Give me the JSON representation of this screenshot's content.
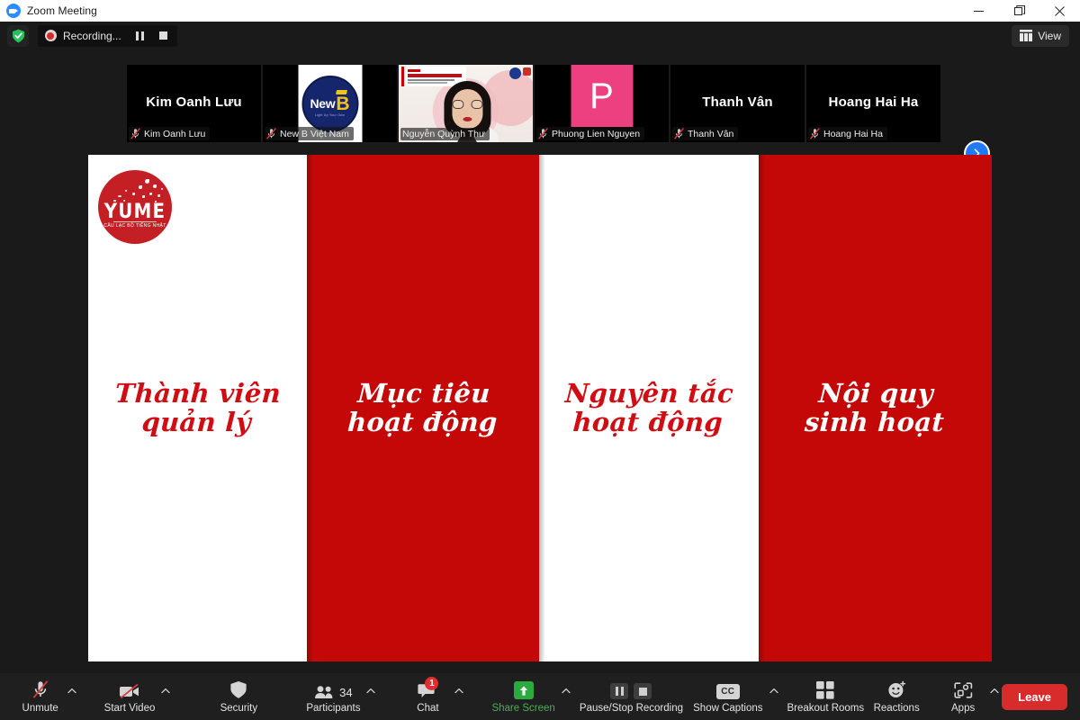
{
  "window": {
    "title": "Zoom Meeting",
    "logo_icon": "zoom-logo-icon",
    "minimize_icon": "minimize-icon",
    "restore_icon": "restore-icon",
    "close_icon": "close-icon"
  },
  "header": {
    "shield_icon": "shield-check-icon",
    "recording_label": "Recording...",
    "recording_dot_icon": "record-dot-icon",
    "pause_icon": "pause-icon",
    "stop_icon": "stop-icon",
    "view_label": "View",
    "view_icon": "grid-view-icon"
  },
  "participants_strip": {
    "next_page_icon": "chevron-right-icon",
    "thumbnails": [
      {
        "display_name": "Kim Oanh Lưu",
        "label": "Kim Oanh Lưu",
        "muted": true,
        "kind": "name-only"
      },
      {
        "display_name": "New B Việt Nam",
        "label": "New B Việt Nam",
        "muted": true,
        "kind": "logo",
        "logo_text": "New",
        "logo_letter": "B",
        "logo_tagline": "Light Up Your Own"
      },
      {
        "display_name": "Nguyễn Quỳnh Thư",
        "label": "Nguyễn Quỳnh Thư",
        "muted": false,
        "kind": "video",
        "corner_number": "2"
      },
      {
        "display_name": "Phuong Lien Nguyen",
        "label": "Phuong Lien Nguyen",
        "muted": true,
        "kind": "avatar",
        "avatar_letter": "P"
      },
      {
        "display_name": "Thanh Vân",
        "label": "Thanh Vân",
        "muted": true,
        "kind": "name-only"
      },
      {
        "display_name": "Hoang Hai Ha",
        "label": "Hoang Hai Ha",
        "muted": true,
        "kind": "name-only"
      }
    ]
  },
  "slide": {
    "logo": {
      "name": "YUME",
      "tagline": "CÂU LẠC BỘ TIẾNG NHẬT"
    },
    "columns": [
      {
        "title_line1": "Thành viên",
        "title_line2": "quản lý",
        "bg": "white",
        "text_color": "#cf0d13"
      },
      {
        "title_line1": "Mục tiêu",
        "title_line2": "hoạt động",
        "bg": "red",
        "text_color": "#ffffff"
      },
      {
        "title_line1": "Nguyên tắc",
        "title_line2": "hoạt động",
        "bg": "white",
        "text_color": "#cf0d13"
      },
      {
        "title_line1": "Nội quy",
        "title_line2": "sinh hoạt",
        "bg": "red",
        "text_color": "#ffffff"
      }
    ],
    "red_hex": "#c40808"
  },
  "toolbar": {
    "mute": {
      "label": "Unmute",
      "icon": "microphone-muted-icon",
      "has_caret": true
    },
    "video": {
      "label": "Start Video",
      "icon": "video-camera-off-icon",
      "has_caret": true
    },
    "security": {
      "label": "Security",
      "icon": "shield-icon",
      "has_caret": false
    },
    "participants": {
      "label": "Participants",
      "icon": "people-icon",
      "count": "34",
      "has_caret": true
    },
    "chat": {
      "label": "Chat",
      "icon": "chat-bubble-icon",
      "badge": "1",
      "has_caret": true
    },
    "share": {
      "label": "Share Screen",
      "icon": "share-screen-up-arrow-icon",
      "has_caret": true
    },
    "recording": {
      "label": "Pause/Stop Recording",
      "pause_icon": "pause-icon",
      "stop_icon": "stop-icon",
      "has_caret": false
    },
    "captions": {
      "label": "Show Captions",
      "icon": "closed-captions-icon",
      "badge_text": "CC",
      "has_caret": true
    },
    "breakout": {
      "label": "Breakout Rooms",
      "icon": "breakout-rooms-grid-icon",
      "has_caret": false
    },
    "reactions": {
      "label": "Reactions",
      "icon": "smiley-reaction-icon",
      "has_caret": false
    },
    "apps": {
      "label": "Apps",
      "icon": "apps-icon",
      "has_caret": true
    },
    "leave": {
      "label": "Leave",
      "color": "#d82b2b"
    }
  }
}
